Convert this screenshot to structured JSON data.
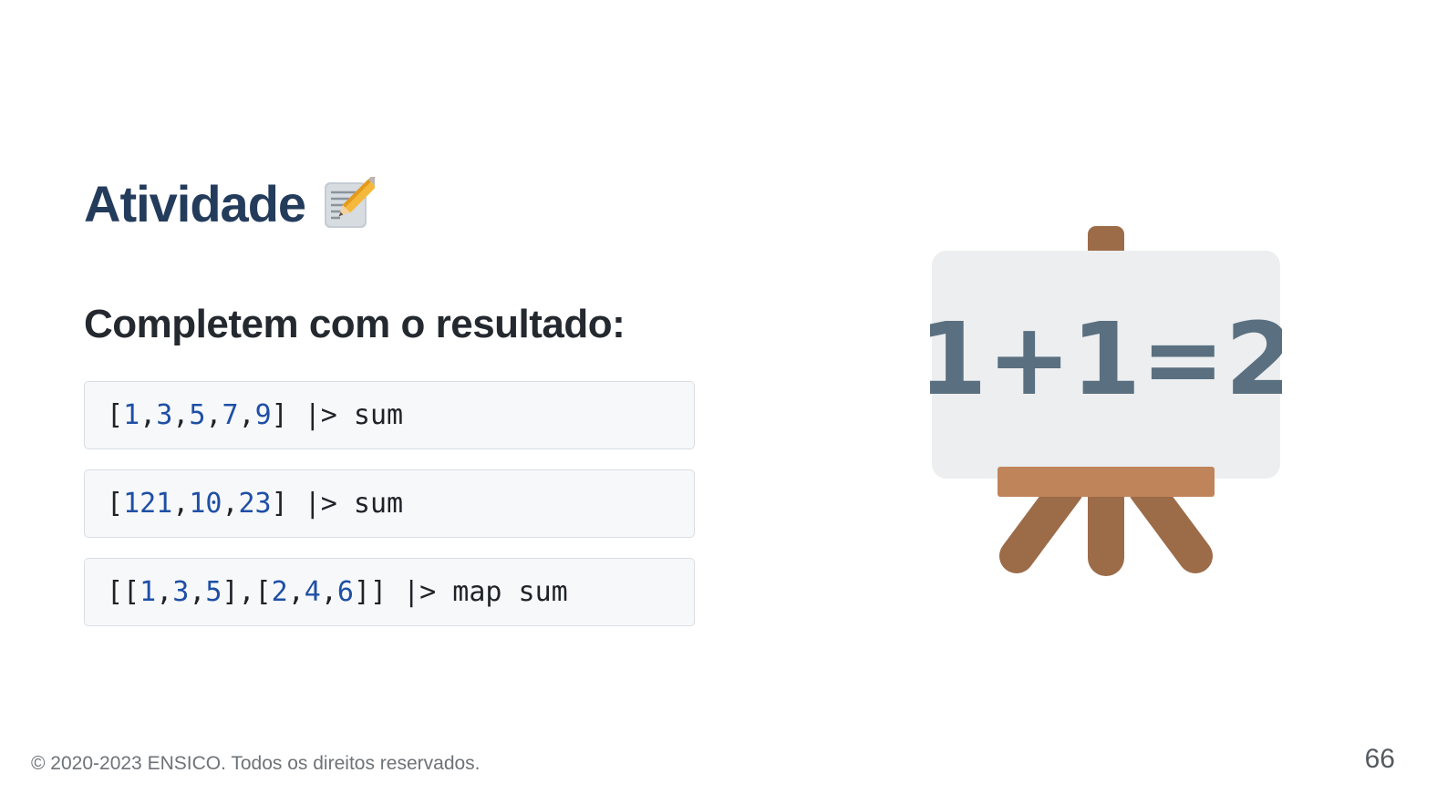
{
  "slide": {
    "title": "Atividade",
    "title_icon": "memo-icon",
    "subtitle": "Completem com o resultado:",
    "code_blocks": [
      {
        "tokens": [
          {
            "text": "[",
            "type": "punct"
          },
          {
            "text": "1",
            "type": "num"
          },
          {
            "text": ",",
            "type": "punct"
          },
          {
            "text": "3",
            "type": "num"
          },
          {
            "text": ",",
            "type": "punct"
          },
          {
            "text": "5",
            "type": "num"
          },
          {
            "text": ",",
            "type": "punct"
          },
          {
            "text": "7",
            "type": "num"
          },
          {
            "text": ",",
            "type": "punct"
          },
          {
            "text": "9",
            "type": "num"
          },
          {
            "text": "] |> sum",
            "type": "punct"
          }
        ]
      },
      {
        "tokens": [
          {
            "text": "[",
            "type": "punct"
          },
          {
            "text": "121",
            "type": "num"
          },
          {
            "text": ",",
            "type": "punct"
          },
          {
            "text": "10",
            "type": "num"
          },
          {
            "text": ",",
            "type": "punct"
          },
          {
            "text": "23",
            "type": "num"
          },
          {
            "text": "] |> sum",
            "type": "punct"
          }
        ]
      },
      {
        "tokens": [
          {
            "text": "[[",
            "type": "punct"
          },
          {
            "text": "1",
            "type": "num"
          },
          {
            "text": ",",
            "type": "punct"
          },
          {
            "text": "3",
            "type": "num"
          },
          {
            "text": ",",
            "type": "punct"
          },
          {
            "text": "5",
            "type": "num"
          },
          {
            "text": "],[",
            "type": "punct"
          },
          {
            "text": "2",
            "type": "num"
          },
          {
            "text": ",",
            "type": "punct"
          },
          {
            "text": "4",
            "type": "num"
          },
          {
            "text": ",",
            "type": "punct"
          },
          {
            "text": "6",
            "type": "num"
          },
          {
            "text": "]] |> map sum",
            "type": "punct"
          }
        ]
      }
    ],
    "illustration": {
      "icon": "easel-board-icon",
      "board_text": "1+1=2"
    }
  },
  "footer": {
    "copyright": "© 2020-2023 ENSICO. Todos os direitos reservados.",
    "page_number": "66"
  },
  "colors": {
    "title": "#243c5c",
    "code_number": "#1f4fa5",
    "code_background": "#f6f8fa",
    "board": "#eceef0",
    "board_text": "#5a7080",
    "easel_wood": "#9c6b48",
    "easel_tray": "#c0845a"
  }
}
